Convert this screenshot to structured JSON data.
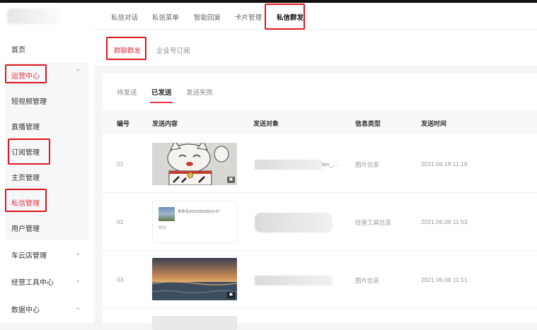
{
  "sidebar": {
    "home": "首页",
    "operations_center": "运营中心",
    "items": [
      "短视频管理",
      "直播管理",
      "订阅管理",
      "主页管理",
      "私信管理",
      "用户管理"
    ],
    "groups": [
      "车云店管理",
      "经营工具中心",
      "数据中心"
    ]
  },
  "nav": {
    "tabs": [
      "私信对话",
      "私信菜单",
      "智能回复",
      "卡片管理",
      "私信群发"
    ],
    "active": "私信群发"
  },
  "subnav": {
    "tabs": [
      "群聊群发",
      "企业号订阅"
    ]
  },
  "content": {
    "tabs": [
      "待发送",
      "已发送",
      "发送失败"
    ],
    "columns": [
      "编号",
      "发送内容",
      "发送对象",
      "信息类型",
      "发送时间"
    ],
    "rows": [
      {
        "no": "01",
        "target_suffix": "iev_...",
        "type": "图片信息",
        "time": "2021.06.18 11:19"
      },
      {
        "no": "02",
        "card_text": "未命名2021/05/28/20:47",
        "card_tag": "链接",
        "type": "经营工具信息",
        "time": "2021.06.08 11:53"
      },
      {
        "no": "03",
        "type": "图片信息",
        "time": "2021.06.08 11:51"
      }
    ]
  },
  "colors": {
    "accent": "#e8343f",
    "highlight_box": "#e0161f"
  }
}
